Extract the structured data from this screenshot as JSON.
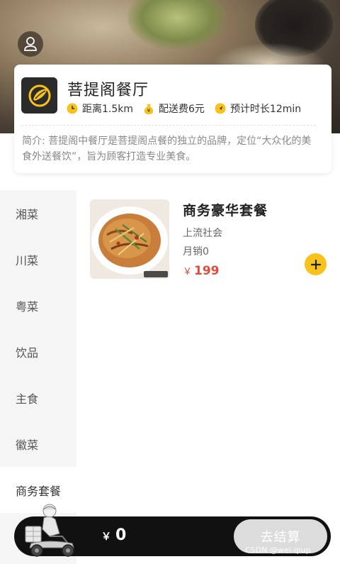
{
  "shop": {
    "name": "菩提阁餐厅",
    "distance": "距离1.5km",
    "delivery_fee": "配送费6元",
    "eta": "预计时长12min",
    "intro": "简介: 菩提阁中餐厅是菩提阁点餐的独立的品牌，定位“大众化的美食外送餐饮”，旨为顾客打造专业美食。"
  },
  "categories": [
    {
      "label": "湘菜",
      "active": false
    },
    {
      "label": "川菜",
      "active": false
    },
    {
      "label": "粤菜",
      "active": false
    },
    {
      "label": "饮品",
      "active": false
    },
    {
      "label": "主食",
      "active": false
    },
    {
      "label": "徽菜",
      "active": false
    },
    {
      "label": "商务套餐",
      "active": true
    }
  ],
  "product": {
    "name": "商务豪华套餐",
    "subtitle": "上流社会",
    "sales": "月销0",
    "currency": "￥",
    "price": "199"
  },
  "cart": {
    "currency": "￥",
    "total": "0",
    "checkout_label": "去结算"
  },
  "watermark": "CSDN @wei-qiup",
  "colors": {
    "accent": "#f6c21b",
    "price": "#e24a3b",
    "cart_bar": "#111111",
    "checkout_disabled": "#dcdcdc"
  }
}
